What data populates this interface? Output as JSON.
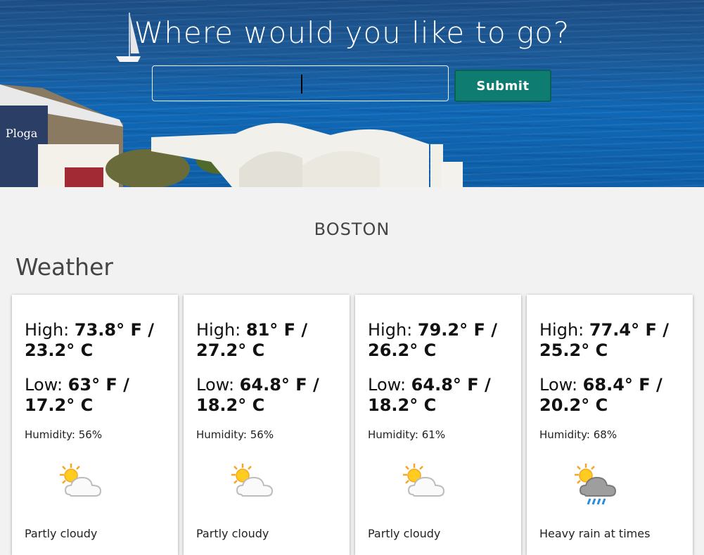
{
  "hero": {
    "title": "Where would you like to go?",
    "search": {
      "value": "",
      "placeholder": ""
    },
    "submit_label": "Submit"
  },
  "city": "BOSTON",
  "section_title": "Weather",
  "forecast": [
    {
      "high_label": "High: ",
      "high": "73.8° F / 23.2° C",
      "low_label": "Low: ",
      "low": "63° F / 17.2° C",
      "humidity": "Humidity: 56%",
      "icon": "partly-cloudy-icon",
      "condition": "Partly cloudy"
    },
    {
      "high_label": "High: ",
      "high": "81° F / 27.2° C",
      "low_label": "Low: ",
      "low": "64.8° F / 18.2° C",
      "humidity": "Humidity: 56%",
      "icon": "partly-cloudy-icon",
      "condition": "Partly cloudy"
    },
    {
      "high_label": "High: ",
      "high": "79.2° F / 26.2° C",
      "low_label": "Low: ",
      "low": "64.8° F / 18.2° C",
      "humidity": "Humidity: 61%",
      "icon": "partly-cloudy-icon",
      "condition": "Partly cloudy"
    },
    {
      "high_label": "High: ",
      "high": "77.4° F / 25.2° C",
      "low_label": "Low: ",
      "low": "68.4° F / 20.2° C",
      "humidity": "Humidity: 68%",
      "icon": "heavy-rain-icon",
      "condition": "Heavy rain at times"
    }
  ],
  "colors": {
    "submit": "#0f7c72",
    "sea": "#0f68b6",
    "background": "#f2f2f2"
  }
}
